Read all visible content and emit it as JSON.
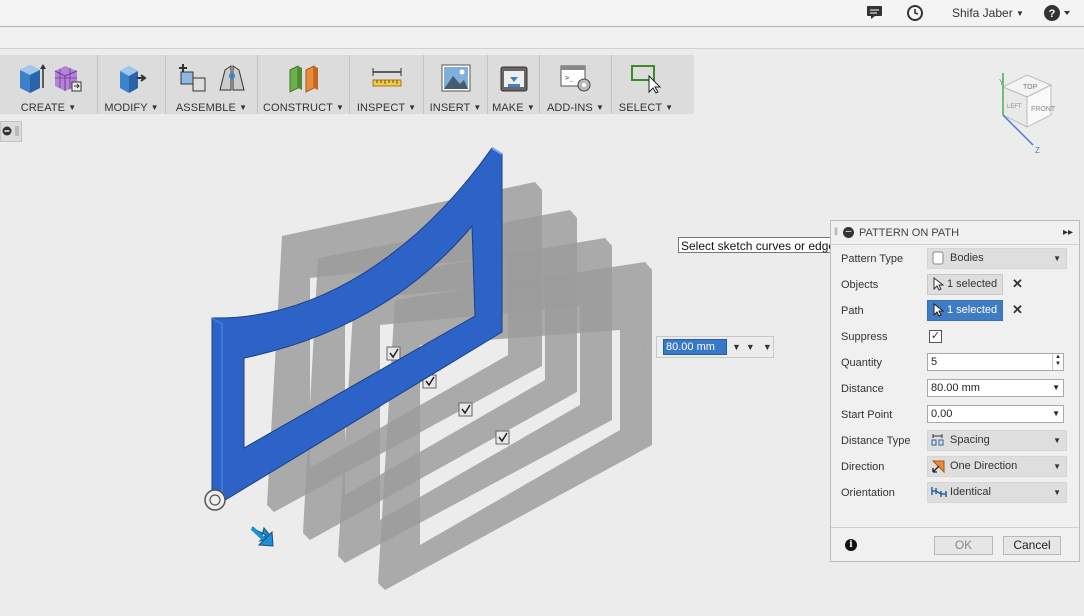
{
  "topbar": {
    "user_name": "Shifa Jaber",
    "icons": [
      "comment-icon",
      "clock-icon",
      "help-icon"
    ]
  },
  "toolbar": {
    "groups": [
      {
        "label": "CREATE"
      },
      {
        "label": "MODIFY"
      },
      {
        "label": "ASSEMBLE"
      },
      {
        "label": "CONSTRUCT"
      },
      {
        "label": "INSPECT"
      },
      {
        "label": "INSERT"
      },
      {
        "label": "MAKE"
      },
      {
        "label": "ADD-INS"
      },
      {
        "label": "SELECT"
      }
    ]
  },
  "viewport": {
    "tooltip": "Select sketch curves or edges",
    "distance_input": "80.00 mm",
    "viewcube": {
      "top": "TOP",
      "left": "LEFT",
      "front": "FRONT",
      "axis_y": "Y",
      "axis_z": "Z"
    }
  },
  "panel": {
    "title": "PATTERN ON PATH",
    "pattern_type": {
      "label": "Pattern Type",
      "value": "Bodies"
    },
    "objects": {
      "label": "Objects",
      "value": "1 selected"
    },
    "path": {
      "label": "Path",
      "value": "1 selected"
    },
    "suppress": {
      "label": "Suppress",
      "checked": true
    },
    "quantity": {
      "label": "Quantity",
      "value": "5"
    },
    "distance": {
      "label": "Distance",
      "value": "80.00 mm"
    },
    "start_point": {
      "label": "Start Point",
      "value": "0.00"
    },
    "distance_type": {
      "label": "Distance Type",
      "value": "Spacing"
    },
    "direction": {
      "label": "Direction",
      "value": "One Direction"
    },
    "orientation": {
      "label": "Orientation",
      "value": "Identical"
    },
    "ok_label": "OK",
    "cancel_label": "Cancel"
  },
  "colors": {
    "body_blue": "#2d63c6",
    "ghost_gray": "#9b9b9b",
    "selection_blue": "#3f7cc4"
  }
}
